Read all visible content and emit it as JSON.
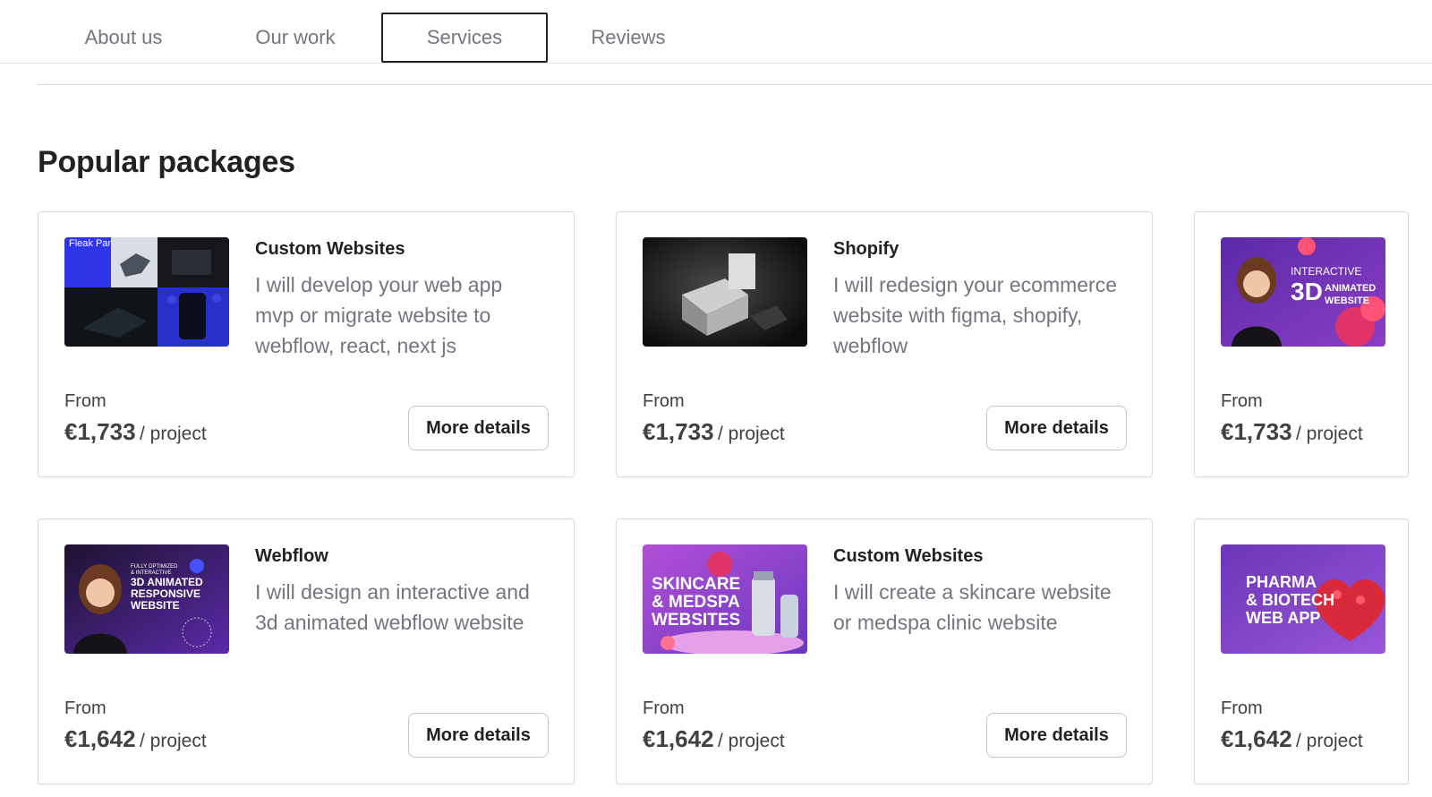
{
  "tabs": [
    {
      "label": "About us",
      "active": false
    },
    {
      "label": "Our work",
      "active": false
    },
    {
      "label": "Services",
      "active": true
    },
    {
      "label": "Reviews",
      "active": false
    }
  ],
  "section_title": "Popular packages",
  "packages": [
    {
      "category": "Custom Websites",
      "description": "I will develop your web app mvp or migrate website to webflow, react, next js",
      "from_label": "From",
      "price": "€1,733",
      "unit": "/ project",
      "button_label": "More details",
      "thumb_text": "Fleak Panel"
    },
    {
      "category": "Shopify",
      "description": "I will redesign your ecommerce website with figma, shopify, webflow",
      "from_label": "From",
      "price": "€1,733",
      "unit": "/ project",
      "button_label": "More details"
    },
    {
      "from_label": "From",
      "price": "€1,733",
      "unit": "/ project",
      "thumb_text": [
        "INTERACTIVE",
        "3D",
        "ANIMATED",
        "WEBSITE"
      ]
    },
    {
      "category": "Webflow",
      "description": "I will design an interactive and 3d animated webflow website",
      "from_label": "From",
      "price": "€1,642",
      "unit": "/ project",
      "button_label": "More details",
      "thumb_text": [
        "FULLY OPTIMIZED",
        "& INTERACTIVE",
        "3D ANIMATED",
        "RESPONSIVE",
        "WEBSITE"
      ]
    },
    {
      "category": "Custom Websites",
      "description": "I will create a skincare website or medspa clinic website",
      "from_label": "From",
      "price": "€1,642",
      "unit": "/ project",
      "button_label": "More details",
      "thumb_text": [
        "SKINCARE",
        "& MEDSPA",
        "WEBSITES"
      ]
    },
    {
      "from_label": "From",
      "price": "€1,642",
      "unit": "/ project",
      "thumb_text": [
        "PHARMA",
        "& BIOTECH",
        "WEB APP"
      ]
    }
  ],
  "colors": {
    "text_primary": "#222222",
    "text_muted": "#74767e",
    "border": "#dadbdd",
    "thumb_purple": "#5b2a9e",
    "thumb_pink": "#e0336a"
  },
  "icons": [
    "fleak-panel-thumbnail",
    "shopify-product-thumbnail",
    "interactive-3d-thumbnail",
    "webflow-3d-thumbnail",
    "skincare-medspa-thumbnail",
    "pharma-biotech-thumbnail"
  ]
}
